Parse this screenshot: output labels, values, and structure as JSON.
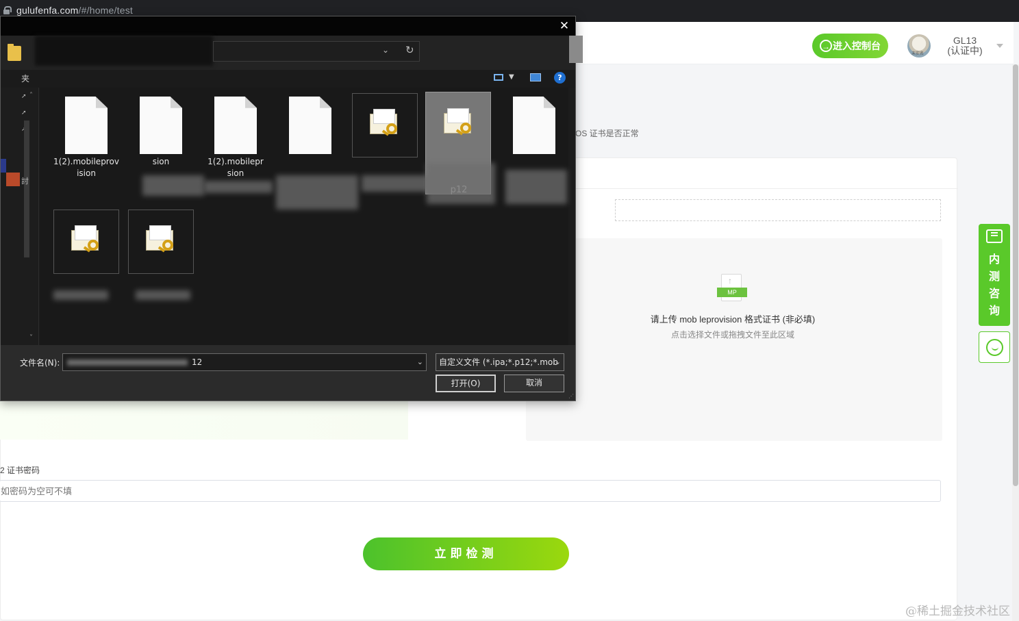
{
  "browser": {
    "url_host": "gulufenfa.com",
    "url_path": "/#/home/test"
  },
  "site": {
    "header": {
      "console_button": "进入控制台",
      "avatar_caption": "未实名",
      "user_name": "GL13",
      "user_status": "(认证中)"
    },
    "description": "OS 证书是否正常",
    "upload": {
      "badge": "MP",
      "title": "请上传 mob leprovision 格式证书 (非必填)",
      "subtitle": "点击选择文件或拖拽文件至此区域"
    },
    "password": {
      "label": "2 证书密码",
      "placeholder": "如密码为空可不填"
    },
    "submit_button": "立即检测",
    "float": {
      "consult_label": "内测咨询"
    },
    "watermark": "@稀土掘金技术社区"
  },
  "dialog": {
    "close_glyph": "✕",
    "nav_label": "夹",
    "nav_letter": "討",
    "files": [
      {
        "type": "doc",
        "label": "1(2).mobileprov\nision"
      },
      {
        "type": "doc",
        "label": "sion"
      },
      {
        "type": "doc",
        "label": "1(2).mobilepr\nsion"
      },
      {
        "type": "doc",
        "label": ""
      },
      {
        "type": "cert",
        "label": ""
      },
      {
        "type": "cert",
        "label": "p12",
        "selected": true
      },
      {
        "type": "doc",
        "label": ""
      },
      {
        "type": "cert",
        "label": ""
      },
      {
        "type": "cert",
        "label": ""
      }
    ],
    "filename_label": "文件名(N):",
    "filename_value": "12",
    "filter_value": "自定义文件 (*.ipa;*.p12;*.mob",
    "open_button": "打开(O)",
    "cancel_button": "取消"
  },
  "colors": {
    "brand_green": "#5ac92a",
    "dialog_bg": "#1c1c1c"
  }
}
